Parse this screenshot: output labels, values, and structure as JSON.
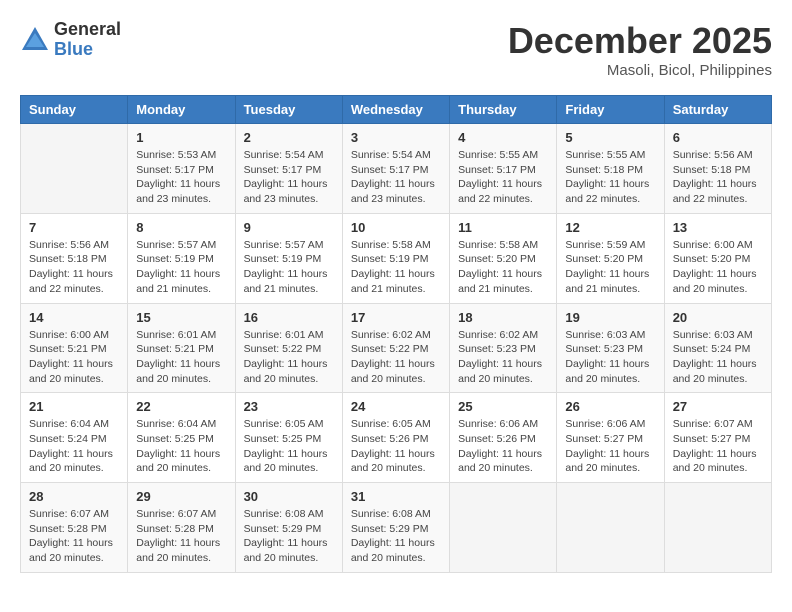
{
  "header": {
    "logo_general": "General",
    "logo_blue": "Blue",
    "month_title": "December 2025",
    "location": "Masoli, Bicol, Philippines"
  },
  "days_of_week": [
    "Sunday",
    "Monday",
    "Tuesday",
    "Wednesday",
    "Thursday",
    "Friday",
    "Saturday"
  ],
  "weeks": [
    [
      {
        "day": "",
        "info": ""
      },
      {
        "day": "1",
        "info": "Sunrise: 5:53 AM\nSunset: 5:17 PM\nDaylight: 11 hours and 23 minutes."
      },
      {
        "day": "2",
        "info": "Sunrise: 5:54 AM\nSunset: 5:17 PM\nDaylight: 11 hours and 23 minutes."
      },
      {
        "day": "3",
        "info": "Sunrise: 5:54 AM\nSunset: 5:17 PM\nDaylight: 11 hours and 23 minutes."
      },
      {
        "day": "4",
        "info": "Sunrise: 5:55 AM\nSunset: 5:17 PM\nDaylight: 11 hours and 22 minutes."
      },
      {
        "day": "5",
        "info": "Sunrise: 5:55 AM\nSunset: 5:18 PM\nDaylight: 11 hours and 22 minutes."
      },
      {
        "day": "6",
        "info": "Sunrise: 5:56 AM\nSunset: 5:18 PM\nDaylight: 11 hours and 22 minutes."
      }
    ],
    [
      {
        "day": "7",
        "info": "Sunrise: 5:56 AM\nSunset: 5:18 PM\nDaylight: 11 hours and 22 minutes."
      },
      {
        "day": "8",
        "info": "Sunrise: 5:57 AM\nSunset: 5:19 PM\nDaylight: 11 hours and 21 minutes."
      },
      {
        "day": "9",
        "info": "Sunrise: 5:57 AM\nSunset: 5:19 PM\nDaylight: 11 hours and 21 minutes."
      },
      {
        "day": "10",
        "info": "Sunrise: 5:58 AM\nSunset: 5:19 PM\nDaylight: 11 hours and 21 minutes."
      },
      {
        "day": "11",
        "info": "Sunrise: 5:58 AM\nSunset: 5:20 PM\nDaylight: 11 hours and 21 minutes."
      },
      {
        "day": "12",
        "info": "Sunrise: 5:59 AM\nSunset: 5:20 PM\nDaylight: 11 hours and 21 minutes."
      },
      {
        "day": "13",
        "info": "Sunrise: 6:00 AM\nSunset: 5:20 PM\nDaylight: 11 hours and 20 minutes."
      }
    ],
    [
      {
        "day": "14",
        "info": "Sunrise: 6:00 AM\nSunset: 5:21 PM\nDaylight: 11 hours and 20 minutes."
      },
      {
        "day": "15",
        "info": "Sunrise: 6:01 AM\nSunset: 5:21 PM\nDaylight: 11 hours and 20 minutes."
      },
      {
        "day": "16",
        "info": "Sunrise: 6:01 AM\nSunset: 5:22 PM\nDaylight: 11 hours and 20 minutes."
      },
      {
        "day": "17",
        "info": "Sunrise: 6:02 AM\nSunset: 5:22 PM\nDaylight: 11 hours and 20 minutes."
      },
      {
        "day": "18",
        "info": "Sunrise: 6:02 AM\nSunset: 5:23 PM\nDaylight: 11 hours and 20 minutes."
      },
      {
        "day": "19",
        "info": "Sunrise: 6:03 AM\nSunset: 5:23 PM\nDaylight: 11 hours and 20 minutes."
      },
      {
        "day": "20",
        "info": "Sunrise: 6:03 AM\nSunset: 5:24 PM\nDaylight: 11 hours and 20 minutes."
      }
    ],
    [
      {
        "day": "21",
        "info": "Sunrise: 6:04 AM\nSunset: 5:24 PM\nDaylight: 11 hours and 20 minutes."
      },
      {
        "day": "22",
        "info": "Sunrise: 6:04 AM\nSunset: 5:25 PM\nDaylight: 11 hours and 20 minutes."
      },
      {
        "day": "23",
        "info": "Sunrise: 6:05 AM\nSunset: 5:25 PM\nDaylight: 11 hours and 20 minutes."
      },
      {
        "day": "24",
        "info": "Sunrise: 6:05 AM\nSunset: 5:26 PM\nDaylight: 11 hours and 20 minutes."
      },
      {
        "day": "25",
        "info": "Sunrise: 6:06 AM\nSunset: 5:26 PM\nDaylight: 11 hours and 20 minutes."
      },
      {
        "day": "26",
        "info": "Sunrise: 6:06 AM\nSunset: 5:27 PM\nDaylight: 11 hours and 20 minutes."
      },
      {
        "day": "27",
        "info": "Sunrise: 6:07 AM\nSunset: 5:27 PM\nDaylight: 11 hours and 20 minutes."
      }
    ],
    [
      {
        "day": "28",
        "info": "Sunrise: 6:07 AM\nSunset: 5:28 PM\nDaylight: 11 hours and 20 minutes."
      },
      {
        "day": "29",
        "info": "Sunrise: 6:07 AM\nSunset: 5:28 PM\nDaylight: 11 hours and 20 minutes."
      },
      {
        "day": "30",
        "info": "Sunrise: 6:08 AM\nSunset: 5:29 PM\nDaylight: 11 hours and 20 minutes."
      },
      {
        "day": "31",
        "info": "Sunrise: 6:08 AM\nSunset: 5:29 PM\nDaylight: 11 hours and 20 minutes."
      },
      {
        "day": "",
        "info": ""
      },
      {
        "day": "",
        "info": ""
      },
      {
        "day": "",
        "info": ""
      }
    ]
  ]
}
